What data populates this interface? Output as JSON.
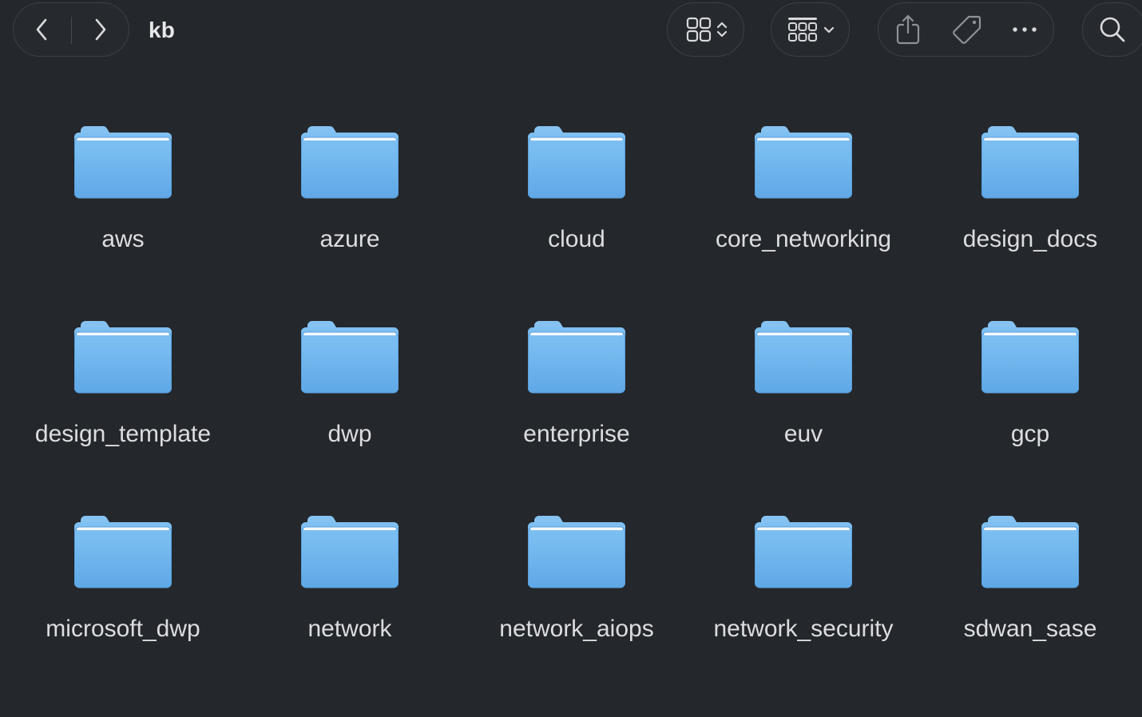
{
  "window": {
    "title": "kb"
  },
  "toolbar": {
    "back_icon": "chevron-left-icon",
    "forward_icon": "chevron-right-icon",
    "view_icon": "icon-grid-view-icon",
    "view_chooser_icon": "chevron-updown-icon",
    "group_icon": "group-by-icon",
    "group_chooser_icon": "chevron-down-icon",
    "share_icon": "share-icon",
    "tag_icon": "tag-icon",
    "more_icon": "ellipsis-icon",
    "search_icon": "search-icon"
  },
  "colors": {
    "background": "#24272b",
    "folder_top": "#88c4f2",
    "folder_body": "#6db3ec",
    "folder_edge": "#4f9ad9",
    "text": "#dcdde0"
  },
  "folders": [
    {
      "name": "aws"
    },
    {
      "name": "azure"
    },
    {
      "name": "cloud"
    },
    {
      "name": "core_networking"
    },
    {
      "name": "design_docs"
    },
    {
      "name": "design_template"
    },
    {
      "name": "dwp"
    },
    {
      "name": "enterprise"
    },
    {
      "name": "euv"
    },
    {
      "name": "gcp"
    },
    {
      "name": "microsoft_dwp"
    },
    {
      "name": "network"
    },
    {
      "name": "network_aiops"
    },
    {
      "name": "network_security"
    },
    {
      "name": "sdwan_sase"
    }
  ]
}
